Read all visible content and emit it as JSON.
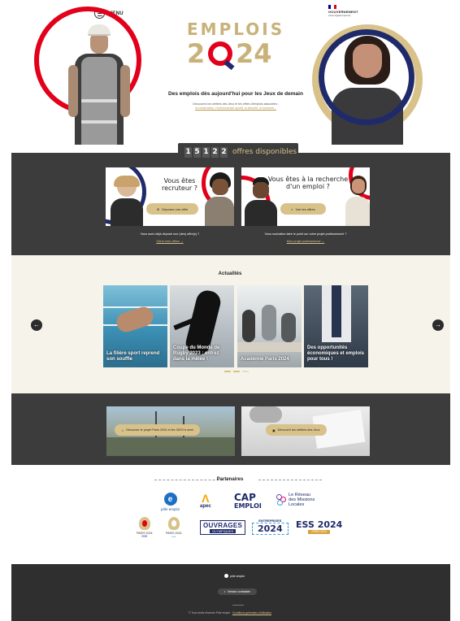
{
  "header": {
    "menu_label": "MENU",
    "gov_title": "GOUVERNEMENT",
    "gov_motto": "Liberté Égalité Fraternité"
  },
  "hero": {
    "logo_word": "EMPLOIS",
    "logo_year_left": "2",
    "logo_year_right": "24",
    "headline": "Des emplois dès aujourd'hui pour les Jeux de demain",
    "subtext": "Découvrez les métiers des Jeux et les offres d'emplois associées :",
    "sectors": "la construction, l'événementiel sportif, la sécurité, le tourisme..."
  },
  "counter": {
    "digits": [
      "1",
      "5",
      "1",
      "2",
      "2"
    ],
    "label": "offres disponibles"
  },
  "cards": {
    "recruteur": {
      "title_line1": "Vous êtes",
      "title_line2": "recruteur ?",
      "button": "Déposer une offre",
      "caption": "Vous avez déjà déposé une (des) offre(s) ?",
      "link": "Gérer mes offres"
    },
    "emploi": {
      "title_line1": "Vous êtes à la recherche",
      "title_line2": "d'un emploi ?",
      "button": "Voir les offres",
      "caption": "Vous souhaitez faire le point sur votre projet professionnel ?",
      "link": "Mon projet professionnel"
    }
  },
  "news": {
    "title": "Actualités",
    "items": [
      {
        "label": "La filière sport reprend son souffle"
      },
      {
        "label": "Coupe du Monde de Rugby 2023 : entrez dans la mêlée !"
      },
      {
        "label": "Académie Paris 2024"
      },
      {
        "label": "Des opportunités économiques et emplois pour tous !"
      }
    ]
  },
  "promos": {
    "projet": "Découvrir le projet Paris 2024 et les GESI à venir",
    "metiers": "Découvrir les métiers des Jeux"
  },
  "partners": {
    "title": "Partenaires",
    "items": {
      "pole_emploi": "pôle emploi",
      "apec": "apec",
      "cap_emploi_1": "CAP",
      "cap_emploi_2": "EMPLOI",
      "missions_1": "Le Réseau",
      "missions_2": "des Missions",
      "missions_3": "Locales",
      "paris_olympic": "PARIS 2024",
      "paris_paralympic": "PARIS 2024",
      "ouvrages_top": "OUVRAGES",
      "ouvrages_bottom": "OLYMPIQUES",
      "entreprises_top": "ENTREPRISES",
      "entreprises_year": "2024",
      "ess": "ESS 2024",
      "ess_sub": "PARIS 2024"
    }
  },
  "footer": {
    "logo": "pôle emploi",
    "button": "Version contrastée",
    "legal": "© Tous droits réservés Pôle emploi",
    "legal_link": "Conditions générales d'utilisation"
  },
  "colors": {
    "gold": "#d8c28a",
    "red": "#e2001a",
    "navy": "#1f2a6b",
    "dark": "#3c3c3c",
    "cream": "#f6f3ea"
  }
}
